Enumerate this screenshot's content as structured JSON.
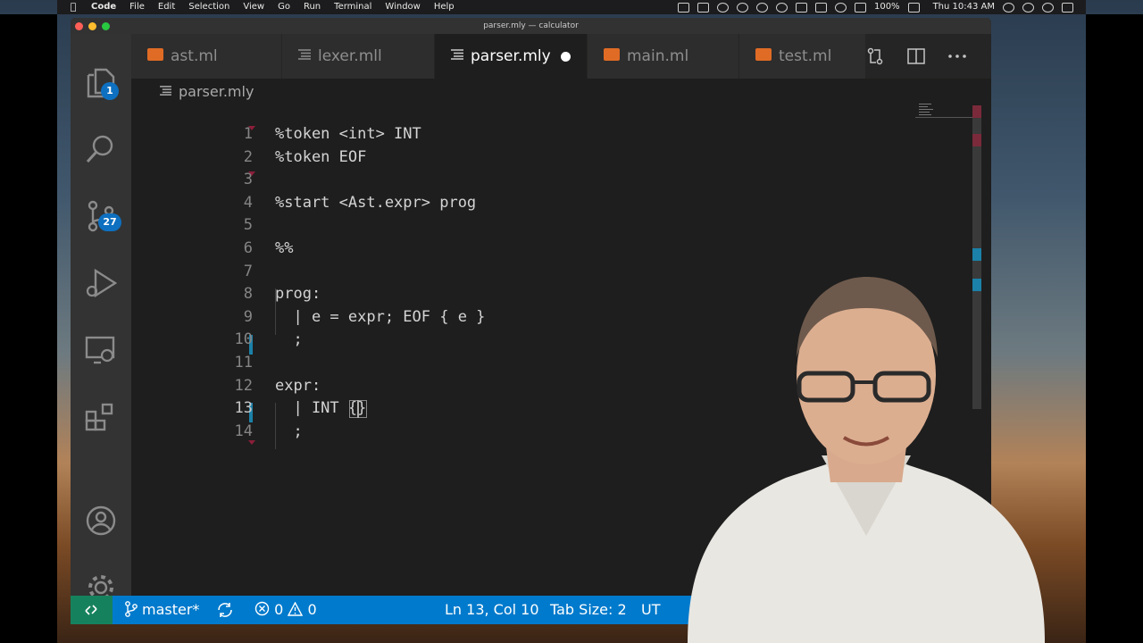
{
  "menubar": {
    "items": [
      "Code",
      "File",
      "Edit",
      "Selection",
      "View",
      "Go",
      "Run",
      "Terminal",
      "Window",
      "Help"
    ],
    "battery": "100%",
    "clock": "Thu 10:43 AM"
  },
  "window": {
    "title": "parser.mly — calculator"
  },
  "activity_bar": {
    "explorer_badge": "1",
    "scm_badge": "27",
    "items": [
      "files-icon",
      "search-icon",
      "source-control-icon",
      "run-debug-icon",
      "remote-explorer-icon",
      "extensions-icon",
      "account-icon",
      "settings-gear-icon"
    ]
  },
  "tabs": [
    {
      "label": "ast.ml",
      "icon": "ocaml-icon",
      "active": false
    },
    {
      "label": "lexer.mll",
      "icon": "lines-icon",
      "active": false
    },
    {
      "label": "parser.mly",
      "icon": "lines-icon",
      "active": true,
      "dirty": true
    },
    {
      "label": "main.ml",
      "icon": "ocaml-icon",
      "active": false
    },
    {
      "label": "test.ml",
      "icon": "ocaml-icon",
      "active": false
    }
  ],
  "breadcrumb": "parser.mly",
  "code": {
    "lines": [
      {
        "n": "1",
        "text": "%token <int> INT"
      },
      {
        "n": "2",
        "text": "%token EOF"
      },
      {
        "n": "3",
        "text": ""
      },
      {
        "n": "4",
        "text": "%start <Ast.expr> prog"
      },
      {
        "n": "5",
        "text": ""
      },
      {
        "n": "6",
        "text": "%%"
      },
      {
        "n": "7",
        "text": ""
      },
      {
        "n": "8",
        "text": "prog:"
      },
      {
        "n": "9",
        "text": "  | e = expr; EOF { e }"
      },
      {
        "n": "10",
        "text": "  ;"
      },
      {
        "n": "11",
        "text": ""
      },
      {
        "n": "12",
        "text": "expr:"
      },
      {
        "n": "13",
        "text": "  | INT {}"
      },
      {
        "n": "14",
        "text": "  ;"
      }
    ],
    "current_line": "13"
  },
  "statusbar": {
    "branch": "master*",
    "errors": "0",
    "warnings": "0",
    "position": "Ln 13, Col 10",
    "tab_size": "Tab Size: 2",
    "encoding": "UT"
  },
  "colors": {
    "accent": "#007acc",
    "remote": "#16825d",
    "badge": "#0e70c0",
    "ocaml": "#e06b25"
  }
}
